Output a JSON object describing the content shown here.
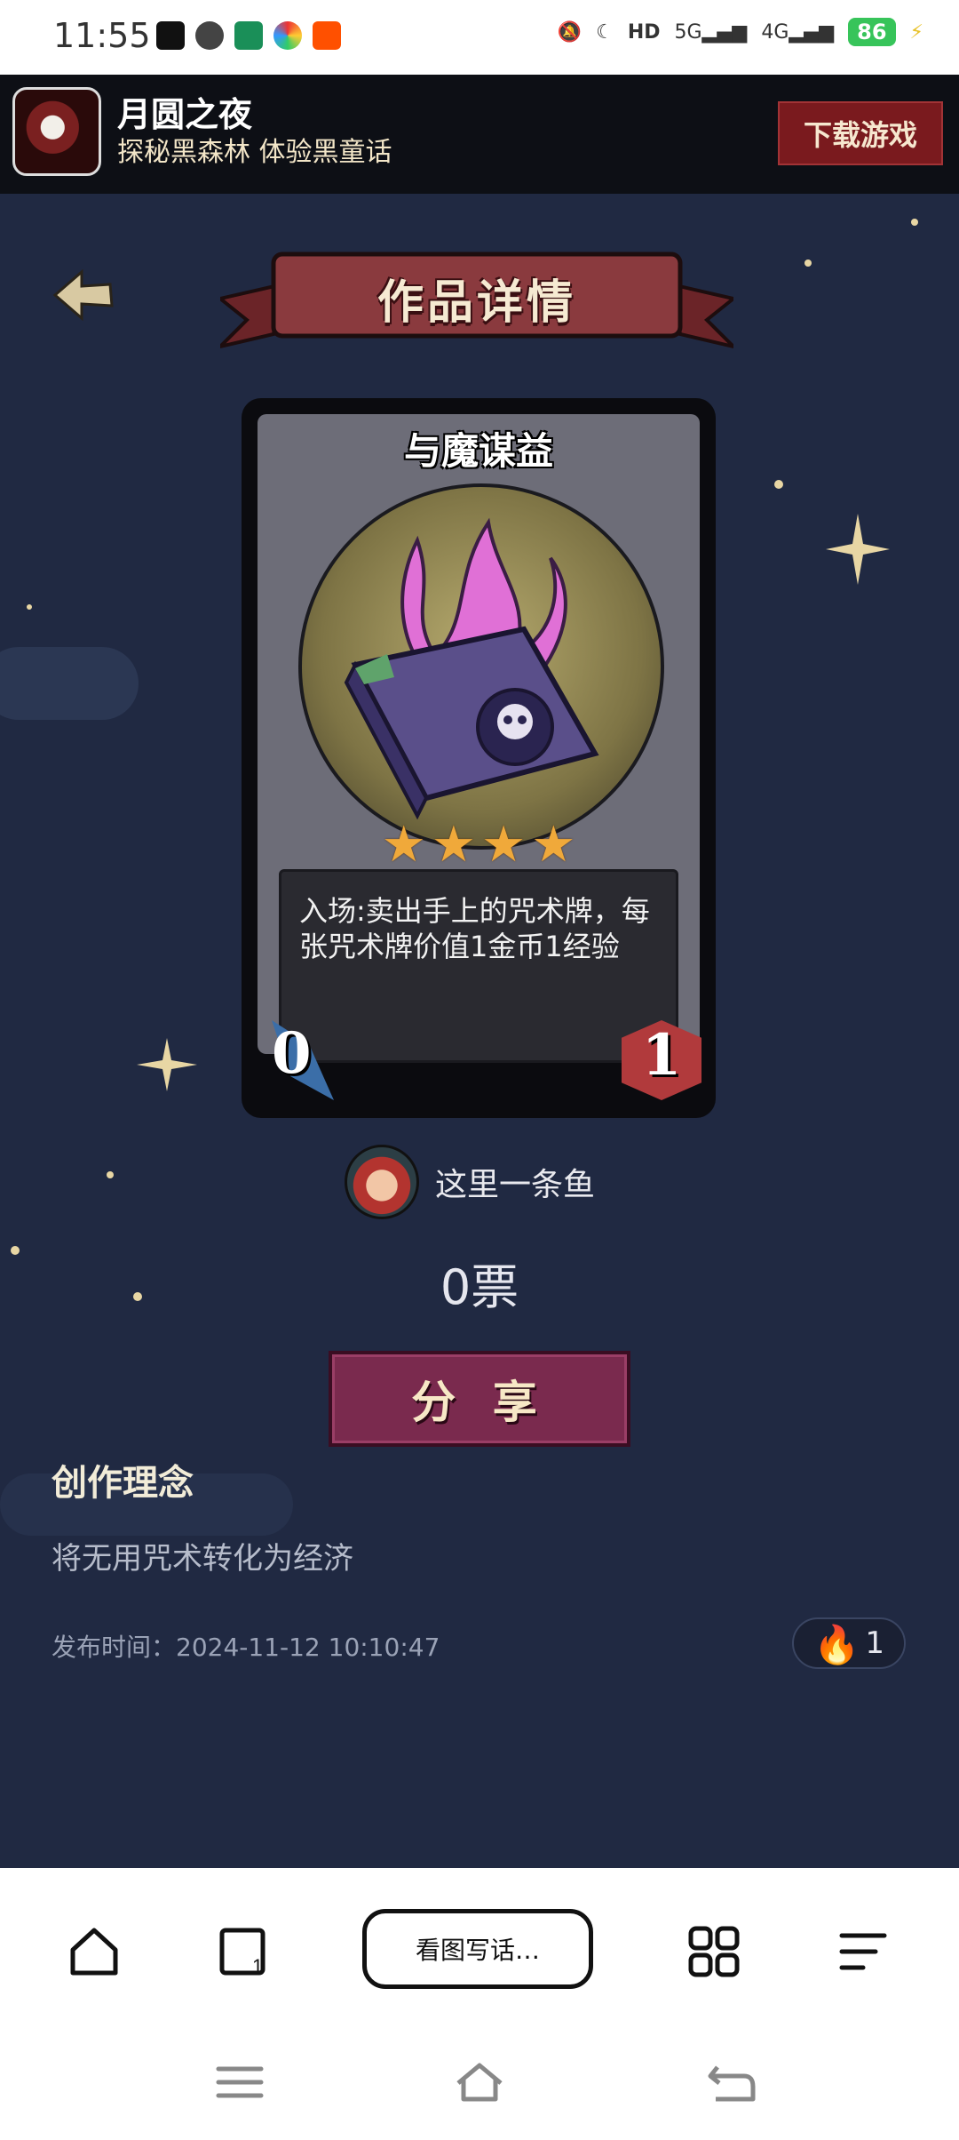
{
  "status": {
    "time": "11:55",
    "battery": "86"
  },
  "banner": {
    "app_name": "月圆之夜",
    "tagline": "探秘黑森林 体验黑童话",
    "download_label": "下载游戏"
  },
  "header": {
    "title": "作品详情"
  },
  "card": {
    "name": "与魔谋益",
    "stars": 4,
    "description": "入场:卖出手上的咒术牌，每张咒术牌价值1金币1经验",
    "cost": "0",
    "level": "1"
  },
  "author": {
    "name": "这里一条鱼"
  },
  "votes": "0票",
  "share_label": "分 享",
  "concept": {
    "heading": "创作理念",
    "text": "将无用咒术转化为经济"
  },
  "publish": {
    "text": "发布时间：2024-11-12 10:10:47"
  },
  "fire_count": "1",
  "bottom": {
    "center_label": "看图写话…"
  },
  "colors": {
    "background": "#202942",
    "share": "#7a2a4e",
    "banner_button": "#7a1a1e",
    "battery": "#37c45a"
  }
}
